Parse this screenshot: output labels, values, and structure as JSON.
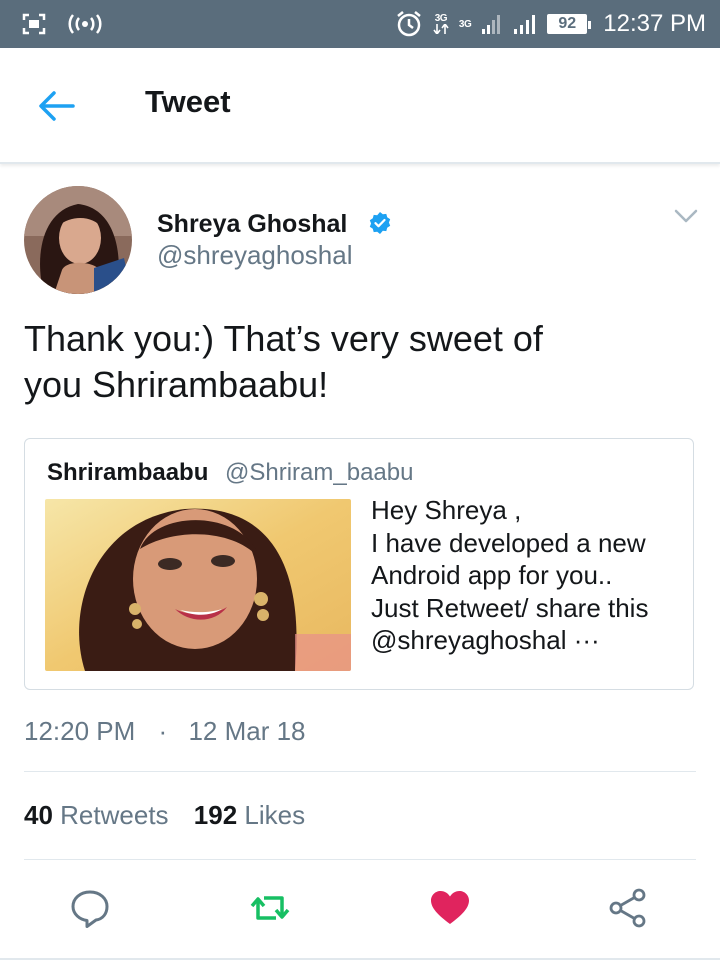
{
  "status_bar": {
    "time": "12:37 PM",
    "battery": "92",
    "net_labels": [
      "3G",
      "3G"
    ],
    "icons": [
      "screenshot-icon",
      "hotspot-icon",
      "alarm-icon",
      "data-arrows-icon",
      "signal-icon",
      "signal-icon"
    ]
  },
  "app_bar": {
    "title": "Tweet",
    "back_icon": "back-arrow-icon"
  },
  "tweet": {
    "author_name": "Shreya Ghoshal",
    "author_handle": "@shreyaghoshal",
    "verified": true,
    "text_line1": "Thank you:) That’s very sweet of",
    "text_line2": "you Shrirambaabu!",
    "quoted": {
      "author_name": "Shrirambaabu",
      "author_handle": "@Shriram_baabu",
      "lines": [
        "Hey Shreya ,",
        "I have developed a new",
        "Android app for you..",
        "Just Retweet/ share this",
        "@shreyaghoshal ···"
      ]
    },
    "time": "12:20 PM",
    "dot": "·",
    "date": "12 Mar 18",
    "retweets_count": "40",
    "retweets_label": "Retweets",
    "likes_count": "192",
    "likes_label": "Likes"
  },
  "colors": {
    "status_bar": "#5a6d7c",
    "twitter_blue": "#1da1f2",
    "retweet_green": "#17bf63",
    "like_red": "#e0245e",
    "muted": "#657786"
  },
  "actions": [
    "reply-icon",
    "retweet-icon",
    "like-icon",
    "share-icon"
  ]
}
